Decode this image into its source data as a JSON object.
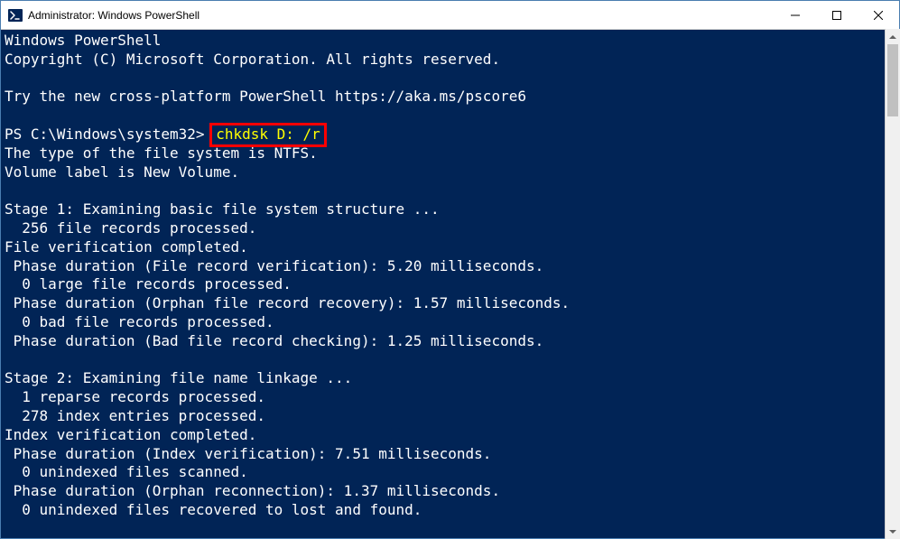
{
  "window": {
    "title": "Administrator: Windows PowerShell"
  },
  "terminal": {
    "header1": "Windows PowerShell",
    "header2": "Copyright (C) Microsoft Corporation. All rights reserved.",
    "tryline": "Try the new cross-platform PowerShell https://aka.ms/pscore6",
    "prompt": "PS C:\\Windows\\system32> ",
    "command": "chkdsk D: /r",
    "fs_type": "The type of the file system is NTFS.",
    "volume_label": "Volume label is New Volume.",
    "stage1_title": "Stage 1: Examining basic file system structure ...",
    "stage1_l1": "  256 file records processed.",
    "stage1_l2": "File verification completed.",
    "stage1_l3": " Phase duration (File record verification): 5.20 milliseconds.",
    "stage1_l4": "  0 large file records processed.",
    "stage1_l5": " Phase duration (Orphan file record recovery): 1.57 milliseconds.",
    "stage1_l6": "  0 bad file records processed.",
    "stage1_l7": " Phase duration (Bad file record checking): 1.25 milliseconds.",
    "stage2_title": "Stage 2: Examining file name linkage ...",
    "stage2_l1": "  1 reparse records processed.",
    "stage2_l2": "  278 index entries processed.",
    "stage2_l3": "Index verification completed.",
    "stage2_l4": " Phase duration (Index verification): 7.51 milliseconds.",
    "stage2_l5": "  0 unindexed files scanned.",
    "stage2_l6": " Phase duration (Orphan reconnection): 1.37 milliseconds.",
    "stage2_l7": "  0 unindexed files recovered to lost and found."
  }
}
